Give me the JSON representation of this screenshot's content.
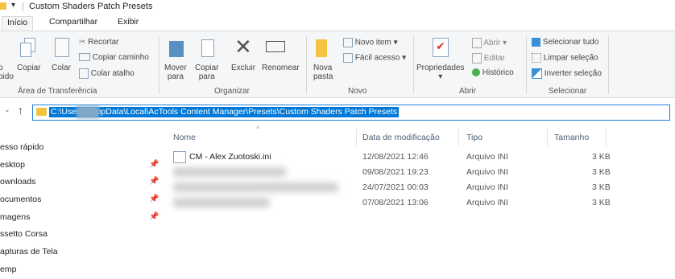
{
  "window": {
    "title": "Custom Shaders Patch Presets"
  },
  "tabs": [
    "Início",
    "Compartilhar",
    "Exibir"
  ],
  "ribbon": {
    "clipboard": {
      "label": "Área de Transferência",
      "access_rapido_line1": "o",
      "access_rapido_line2": "pido",
      "copy": "Copiar",
      "paste": "Colar",
      "cut": "Recortar",
      "copy_path": "Copiar caminho",
      "paste_shortcut": "Colar atalho"
    },
    "organize": {
      "label": "Organizar",
      "move_line1": "Mover",
      "move_line2": "para",
      "copy_line1": "Copiar",
      "copy_line2": "para",
      "delete": "Excluir",
      "rename": "Renomear"
    },
    "new": {
      "label": "Novo",
      "new_folder_line1": "Nova",
      "new_folder_line2": "pasta",
      "new_item": "Novo item",
      "easy_access": "Fácil acesso"
    },
    "open": {
      "label": "Abrir",
      "properties": "Propriedades",
      "open": "Abrir",
      "edit": "Editar",
      "history": "Histórico"
    },
    "select": {
      "label": "Selecionar",
      "select_all": "Selecionar tudo",
      "select_none": "Limpar seleção",
      "invert": "Inverter seleção"
    }
  },
  "address": {
    "path": "C:\\Users\\         \\AppData\\Local\\AcTools Content Manager\\Presets\\Custom Shaders Patch Presets"
  },
  "nav": {
    "items": [
      {
        "label": "esso rápido",
        "pinned": false
      },
      {
        "label": "esktop",
        "pinned": true
      },
      {
        "label": "ownloads",
        "pinned": true
      },
      {
        "label": "ocumentos",
        "pinned": true
      },
      {
        "label": "magens",
        "pinned": true
      },
      {
        "label": "ssetto Corsa",
        "pinned": false
      },
      {
        "label": "apturas de Tela",
        "pinned": false
      },
      {
        "label": "emp",
        "pinned": false
      }
    ]
  },
  "columns": {
    "name": "Nome",
    "date": "Data de modificação",
    "type": "Tipo",
    "size": "Tamanho"
  },
  "files": [
    {
      "name": "CM - Alex Zuotoski.ini",
      "date": "12/08/2021 12:46",
      "type": "Arquivo INI",
      "size": "3 KB"
    },
    {
      "name": "",
      "date": "09/08/2021 19:23",
      "type": "Arquivo INI",
      "size": "3 KB"
    },
    {
      "name": "",
      "date": "24/07/2021 00:03",
      "type": "Arquivo INI",
      "size": "3 KB"
    },
    {
      "name": "",
      "date": "07/08/2021 13:06",
      "type": "Arquivo INI",
      "size": "3 KB"
    }
  ],
  "icons": {
    "pin": "pin-icon",
    "up": "up-arrow-icon",
    "back": "chevron-down-icon"
  }
}
